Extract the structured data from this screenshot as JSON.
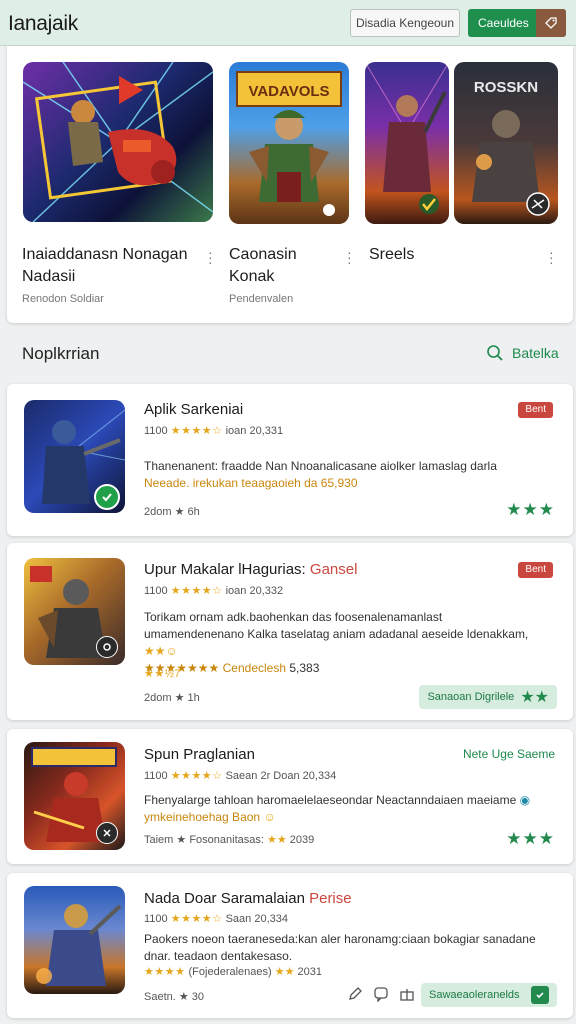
{
  "header": {
    "brand": "Ianajaik",
    "outline_button": "Disadia Kengeoun",
    "primary_button": "Caeuldes"
  },
  "featured": [
    {
      "title": "Inaiaddanasn Nonagan Nadasii",
      "subtitle": "Renodon Soldiar"
    },
    {
      "title": "Caonasin Konak",
      "subtitle": "Pendenvalen"
    },
    {
      "title": "Sreels",
      "subtitle": ""
    }
  ],
  "featured_art": {
    "card2_banner": "VADAVOLS",
    "card3b_banner": "ROSSKN"
  },
  "section": {
    "title": "Noplkrrian",
    "link": "Batelka"
  },
  "apps": [
    {
      "title": "Aplik Sarkeniai",
      "meta_left": "1100",
      "stars": "★★★★☆",
      "meta_right": "ioan 20,331",
      "badge": "Bent",
      "desc_plain": "Thanenanent: fraadde Nan Nnoanalicasane aiolker lamaslag darla ",
      "desc_hl": "Neeade. irekukan teaagaoieh da 65,930",
      "foot": "2dom ★ 6h",
      "action": "★★★"
    },
    {
      "title": "Upur Makalar lHagurias:",
      "title_hl": "Gansel",
      "meta_left": "1100",
      "stars": "★★★★☆",
      "meta_right": "ioan 20,332",
      "badge": "Bent",
      "desc_plain": "Torikam ornam adk.baohenkan das foosenalenamanlast umamendenenano Kalka taselatag aniam adadanal aeseide ldenakkam,",
      "desc_hl": "★★★★★★★ Cendeclesh",
      "desc_tail": "5,383",
      "rating_line": "★★½7",
      "foot": "2dom ★ 1h",
      "action": "Sanaoan Digrilele"
    },
    {
      "title": "Spun Praglanian",
      "meta_left": "1100",
      "stars": "★★★★☆",
      "meta_right": "Saean 2r Doan 20,334",
      "badge": "Nete Uge Saeme",
      "desc_plain": "Fhenyalarge tahloan haromaelelaeseondar Neactanndaiaen maeiame ",
      "desc_hl": "ymkeinehoehag Baon",
      "foot": "Taiem ★ Fosonanitasas:",
      "foot_tail": "2039",
      "action": "★★★"
    },
    {
      "title": "Nada Doar Saramalaian",
      "title_hl": "Perise",
      "meta_left": "1100",
      "stars": "★★★★☆",
      "meta_right": "Saan 20,334",
      "desc_plain": "Paokers noeon taeraneseda:kan aler haronamg:ciaan bokagiar sanadane dnar. teadaon dentakesaso.",
      "rating_line": "★★★★",
      "desc_hl": "(Fojederalenaes)",
      "desc_tail": "2031",
      "foot": "Saetn. ★ 30",
      "action": "Sawaeaoleranelds"
    }
  ],
  "colors": {
    "primary": "#1f8f4e",
    "star": "#e6a61a",
    "badge": "#c9473f",
    "header_bg": "#dfeee6"
  }
}
